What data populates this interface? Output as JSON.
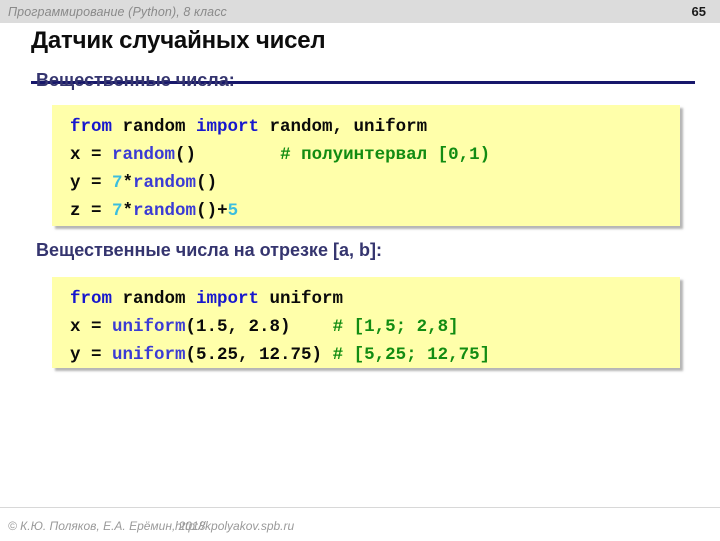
{
  "header": {
    "course": "Программирование (Python), 8 класс",
    "page_number": "65"
  },
  "title": "Датчик случайных чисел",
  "accent_colors": {
    "title_rule": "#17176B",
    "subtitle": "#35356F",
    "code_background": "#FFFFAA",
    "keyword": "#1717CD",
    "function": "#3B3BD4",
    "number": "#3CBEDE",
    "comment": "#128C12",
    "header_background": "#DCDCDC"
  },
  "sections": [
    {
      "subtitle": "Вещественные числа:",
      "code": [
        [
          {
            "t": "from ",
            "c": "kw"
          },
          {
            "t": "random ",
            "c": "plain"
          },
          {
            "t": "import ",
            "c": "kw"
          },
          {
            "t": "random, uniform",
            "c": "plain"
          }
        ],
        [
          {
            "t": "x = ",
            "c": "plain"
          },
          {
            "t": "random",
            "c": "fn"
          },
          {
            "t": "()",
            "c": "plain"
          },
          {
            "t": "        ",
            "c": "plain"
          },
          {
            "t": "# полуинтервал [0,1)",
            "c": "cmt"
          }
        ],
        [
          {
            "t": "y = ",
            "c": "plain"
          },
          {
            "t": "7",
            "c": "num"
          },
          {
            "t": "*",
            "c": "plain"
          },
          {
            "t": "random",
            "c": "fn"
          },
          {
            "t": "()",
            "c": "plain"
          }
        ],
        [
          {
            "t": "z = ",
            "c": "plain"
          },
          {
            "t": "7",
            "c": "num"
          },
          {
            "t": "*",
            "c": "plain"
          },
          {
            "t": "random",
            "c": "fn"
          },
          {
            "t": "()+",
            "c": "plain"
          },
          {
            "t": "5",
            "c": "num"
          }
        ]
      ]
    },
    {
      "subtitle": "Вещественные числа на отрезке [a, b]:",
      "code": [
        [
          {
            "t": "from ",
            "c": "kw"
          },
          {
            "t": "random ",
            "c": "plain"
          },
          {
            "t": "import ",
            "c": "kw"
          },
          {
            "t": "uniform",
            "c": "plain"
          }
        ],
        [
          {
            "t": "x = ",
            "c": "plain"
          },
          {
            "t": "uniform",
            "c": "fn"
          },
          {
            "t": "(1.5, 2.8)",
            "c": "plain"
          },
          {
            "t": "    ",
            "c": "plain"
          },
          {
            "t": "# [1,5; 2,8]",
            "c": "cmt"
          }
        ],
        [
          {
            "t": "y = ",
            "c": "plain"
          },
          {
            "t": "uniform",
            "c": "fn"
          },
          {
            "t": "(5.25, 12.75) ",
            "c": "plain"
          },
          {
            "t": "# [5,25; 12,75]",
            "c": "cmt"
          }
        ]
      ]
    }
  ],
  "footer": {
    "copyright": "© К.Ю. Поляков, Е.А. Ерёмин, 2018",
    "url": "http://kpolyakov.spb.ru"
  }
}
